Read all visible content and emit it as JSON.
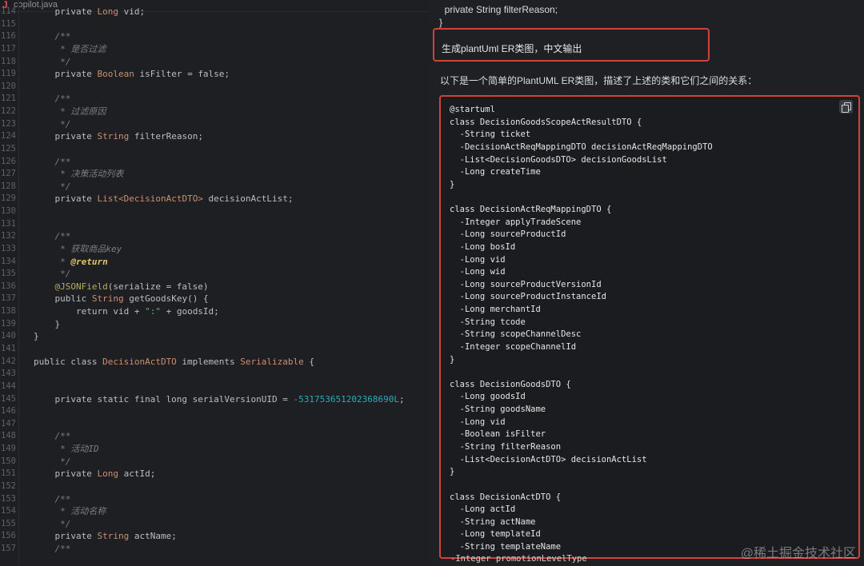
{
  "editor": {
    "tab": {
      "icon": "java-file-icon",
      "filename": "copilot.java"
    },
    "lines": [
      {
        "n": "114",
        "segs": [
          [
            "",
            "    private "
          ],
          [
            "ty",
            "Long"
          ],
          [
            "",
            " vid;"
          ]
        ]
      },
      {
        "n": "115",
        "segs": []
      },
      {
        "n": "116",
        "segs": [
          [
            "cm",
            "    /**"
          ]
        ]
      },
      {
        "n": "117",
        "segs": [
          [
            "cm",
            "     * 是否过滤"
          ]
        ]
      },
      {
        "n": "118",
        "segs": [
          [
            "cm",
            "     */"
          ]
        ]
      },
      {
        "n": "119",
        "segs": [
          [
            "",
            "    private "
          ],
          [
            "ty",
            "Boolean"
          ],
          [
            "",
            " isFilter = false;"
          ]
        ]
      },
      {
        "n": "120",
        "segs": []
      },
      {
        "n": "121",
        "segs": [
          [
            "cm",
            "    /**"
          ]
        ]
      },
      {
        "n": "122",
        "segs": [
          [
            "cm",
            "     * 过滤原因"
          ]
        ]
      },
      {
        "n": "123",
        "segs": [
          [
            "cm",
            "     */"
          ]
        ]
      },
      {
        "n": "124",
        "segs": [
          [
            "",
            "    private "
          ],
          [
            "ty",
            "String"
          ],
          [
            "",
            " filterReason;"
          ]
        ]
      },
      {
        "n": "125",
        "segs": []
      },
      {
        "n": "126",
        "segs": [
          [
            "cm",
            "    /**"
          ]
        ]
      },
      {
        "n": "127",
        "segs": [
          [
            "cm",
            "     * 决策活动列表"
          ]
        ]
      },
      {
        "n": "128",
        "segs": [
          [
            "cm",
            "     */"
          ]
        ]
      },
      {
        "n": "129",
        "segs": [
          [
            "",
            "    private "
          ],
          [
            "ty",
            "List<DecisionActDTO>"
          ],
          [
            "",
            " decisionActList;"
          ]
        ]
      },
      {
        "n": "130",
        "segs": []
      },
      {
        "n": "131",
        "segs": []
      },
      {
        "n": "132",
        "segs": [
          [
            "cm",
            "    /**"
          ]
        ]
      },
      {
        "n": "133",
        "segs": [
          [
            "cm",
            "     * 获取商品key"
          ]
        ]
      },
      {
        "n": "134",
        "segs": [
          [
            "cm",
            "     * "
          ],
          [
            "tag",
            "@return"
          ]
        ]
      },
      {
        "n": "135",
        "segs": [
          [
            "cm",
            "     */"
          ]
        ]
      },
      {
        "n": "136",
        "segs": [
          [
            "an",
            "    @JSONField"
          ],
          [
            "",
            "(serialize = false)"
          ]
        ]
      },
      {
        "n": "137",
        "segs": [
          [
            "",
            "    public "
          ],
          [
            "ty",
            "String"
          ],
          [
            "",
            " getGoodsKey() {"
          ]
        ]
      },
      {
        "n": "138",
        "segs": [
          [
            "",
            "        return vid + "
          ],
          [
            "st",
            "\":\""
          ],
          [
            "",
            " + goodsId;"
          ]
        ]
      },
      {
        "n": "139",
        "segs": [
          [
            "",
            "    }"
          ]
        ]
      },
      {
        "n": "140",
        "segs": [
          [
            "",
            "}"
          ]
        ]
      },
      {
        "n": "141",
        "segs": []
      },
      {
        "n": "142",
        "segs": [
          [
            "",
            "public class "
          ],
          [
            "ty",
            "DecisionActDTO"
          ],
          [
            "",
            " implements "
          ],
          [
            "ty",
            "Serializable"
          ],
          [
            "",
            " {"
          ]
        ]
      },
      {
        "n": "143",
        "segs": []
      },
      {
        "n": "144",
        "segs": []
      },
      {
        "n": "145",
        "segs": [
          [
            "",
            "    private static final long serialVersionUID = "
          ],
          [
            "num",
            "-531753651202368690L"
          ],
          [
            "",
            ";"
          ]
        ]
      },
      {
        "n": "146",
        "segs": []
      },
      {
        "n": "147",
        "segs": []
      },
      {
        "n": "148",
        "segs": [
          [
            "cm",
            "    /**"
          ]
        ]
      },
      {
        "n": "149",
        "segs": [
          [
            "cm",
            "     * 活动ID"
          ]
        ]
      },
      {
        "n": "150",
        "segs": [
          [
            "cm",
            "     */"
          ]
        ]
      },
      {
        "n": "151",
        "segs": [
          [
            "",
            "    private "
          ],
          [
            "ty",
            "Long"
          ],
          [
            "",
            " actId;"
          ]
        ]
      },
      {
        "n": "152",
        "segs": []
      },
      {
        "n": "153",
        "segs": [
          [
            "cm",
            "    /**"
          ]
        ]
      },
      {
        "n": "154",
        "segs": [
          [
            "cm",
            "     * 活动名称"
          ]
        ]
      },
      {
        "n": "155",
        "segs": [
          [
            "cm",
            "     */"
          ]
        ]
      },
      {
        "n": "156",
        "segs": [
          [
            "",
            "    private "
          ],
          [
            "ty",
            "String"
          ],
          [
            "",
            " actName;"
          ]
        ]
      },
      {
        "n": "157",
        "segs": [
          [
            "cm",
            "    /**"
          ]
        ]
      }
    ]
  },
  "chat": {
    "prev_code": [
      "  private String filterReason;",
      "}"
    ],
    "user_message": "生成plantUml ER类图，中文输出",
    "reply_intro": "以下是一个简单的PlantUML ER类图，描述了上述的类和它们之间的关系：",
    "copy_icon": "copy-icon",
    "uml_lines": [
      "@startuml",
      "class DecisionGoodsScopeActResultDTO {",
      "  -String ticket",
      "  -DecisionActReqMappingDTO decisionActReqMappingDTO",
      "  -List<DecisionGoodsDTO> decisionGoodsList",
      "  -Long createTime",
      "}",
      "",
      "class DecisionActReqMappingDTO {",
      "  -Integer applyTradeScene",
      "  -Long sourceProductId",
      "  -Long bosId",
      "  -Long vid",
      "  -Long wid",
      "  -Long sourceProductVersionId",
      "  -Long sourceProductInstanceId",
      "  -Long merchantId",
      "  -String tcode",
      "  -String scopeChannelDesc",
      "  -Integer scopeChannelId",
      "}",
      "",
      "class DecisionGoodsDTO {",
      "  -Long goodsId",
      "  -String goodsName",
      "  -Long vid",
      "  -Boolean isFilter",
      "  -String filterReason",
      "  -List<DecisionActDTO> decisionActList",
      "}",
      "",
      "class DecisionActDTO {",
      "  -Long actId",
      "  -String actName",
      "  -Long templateId",
      "  -String templateName"
    ],
    "below_box": "-Integer promotionLevelType"
  },
  "watermark": "@稀土掘金技术社区"
}
